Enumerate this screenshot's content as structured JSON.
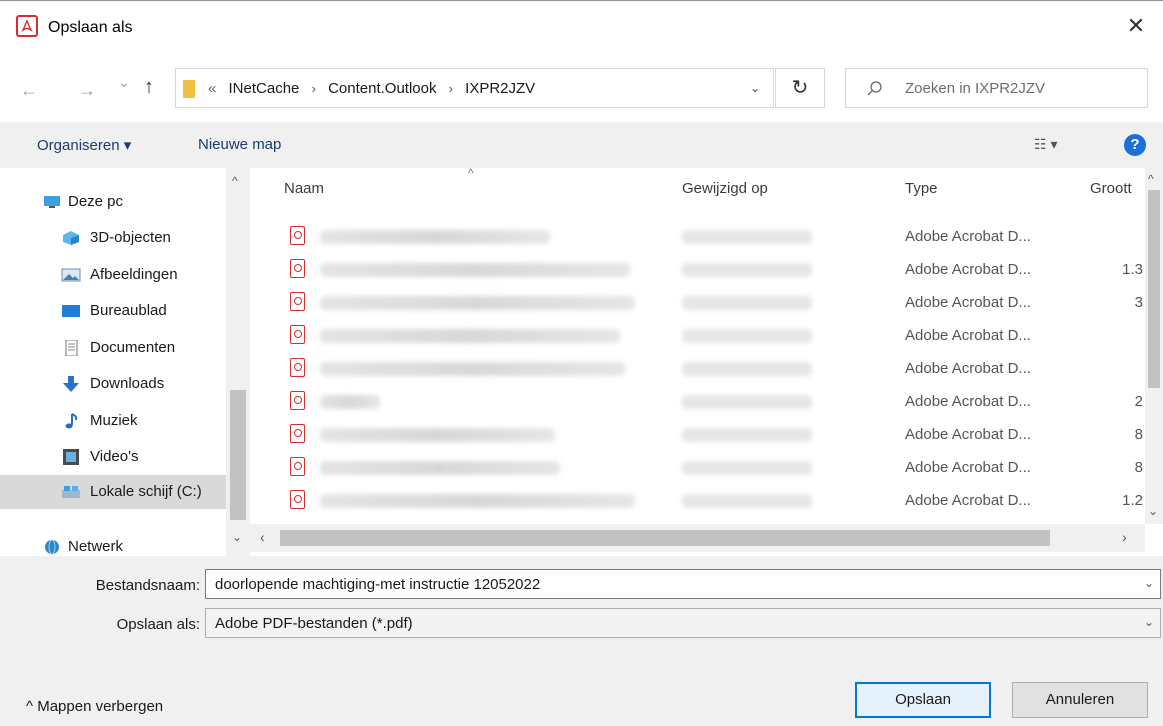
{
  "window": {
    "title": "Opslaan als",
    "close_glyph": "✕"
  },
  "nav": {
    "back_glyph": "←",
    "forward_glyph": "→",
    "recent_glyph": "⌄",
    "up_glyph": "↑",
    "address_prefix": "«",
    "breadcrumbs": [
      "INetCache",
      "Content.Outlook",
      "IXPR2JZV"
    ],
    "refresh_glyph": "↻",
    "search_placeholder": "Zoeken in IXPR2JZV"
  },
  "toolbar": {
    "organise_label": "Organiseren ▾",
    "new_folder_label": "Nieuwe map",
    "view_glyph": "☷ ▾",
    "help_glyph": "?"
  },
  "sidebar": {
    "items": [
      {
        "label": "Deze pc",
        "icon": "computer-icon"
      },
      {
        "label": "3D-objecten",
        "icon": "cube-icon"
      },
      {
        "label": "Afbeeldingen",
        "icon": "pictures-icon"
      },
      {
        "label": "Bureaublad",
        "icon": "desktop-icon"
      },
      {
        "label": "Documenten",
        "icon": "document-icon"
      },
      {
        "label": "Downloads",
        "icon": "download-arrow-icon"
      },
      {
        "label": "Muziek",
        "icon": "music-note-icon"
      },
      {
        "label": "Video's",
        "icon": "film-icon"
      },
      {
        "label": "Lokale schijf (C:)",
        "icon": "drive-icon"
      },
      {
        "label": "Netwerk",
        "icon": "network-icon"
      }
    ],
    "selected_index": 8
  },
  "files": {
    "columns": {
      "name": "Naam",
      "modified": "Gewijzigd op",
      "type": "Type",
      "size": "Groott"
    },
    "sort_glyph": "^",
    "rows": [
      {
        "type": "Adobe Acrobat D...",
        "size": ""
      },
      {
        "type": "Adobe Acrobat D...",
        "size": "1.3"
      },
      {
        "type": "Adobe Acrobat D...",
        "size": "3"
      },
      {
        "type": "Adobe Acrobat D...",
        "size": ""
      },
      {
        "type": "Adobe Acrobat D...",
        "size": ""
      },
      {
        "type": "Adobe Acrobat D...",
        "size": "2"
      },
      {
        "type": "Adobe Acrobat D...",
        "size": "8"
      },
      {
        "type": "Adobe Acrobat D...",
        "size": "8"
      },
      {
        "type": "Adobe Acrobat D...",
        "size": "1.2"
      }
    ]
  },
  "form": {
    "filename_label": "Bestandsnaam:",
    "filename_value": "doorlopende machtiging-met instructie 12052022",
    "savetype_label": "Opslaan als:",
    "savetype_value": "Adobe PDF-bestanden (*.pdf)",
    "chevron_glyph": "⌄"
  },
  "footer": {
    "hide_folders_label": "^  Mappen verbergen",
    "save_label": "Opslaan",
    "cancel_label": "Annuleren"
  },
  "scroll": {
    "left": "‹",
    "right": "›",
    "up": "^",
    "down": "⌄"
  }
}
